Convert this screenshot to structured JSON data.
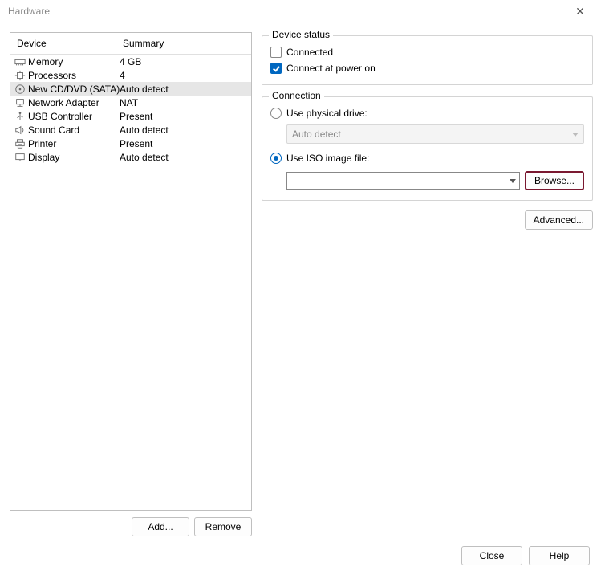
{
  "title": "Hardware",
  "list_header": {
    "device": "Device",
    "summary": "Summary"
  },
  "devices": [
    {
      "icon": "memory",
      "name": "Memory",
      "summary": "4 GB"
    },
    {
      "icon": "cpu",
      "name": "Processors",
      "summary": "4"
    },
    {
      "icon": "disc",
      "name": "New CD/DVD (SATA)",
      "summary": "Auto detect"
    },
    {
      "icon": "network",
      "name": "Network Adapter",
      "summary": "NAT"
    },
    {
      "icon": "usb",
      "name": "USB Controller",
      "summary": "Present"
    },
    {
      "icon": "sound",
      "name": "Sound Card",
      "summary": "Auto detect"
    },
    {
      "icon": "printer",
      "name": "Printer",
      "summary": "Present"
    },
    {
      "icon": "display",
      "name": "Display",
      "summary": "Auto detect"
    }
  ],
  "selected_index": 2,
  "buttons": {
    "add": "Add...",
    "remove": "Remove",
    "advanced": "Advanced...",
    "browse": "Browse...",
    "close": "Close",
    "help": "Help"
  },
  "device_status": {
    "legend": "Device status",
    "connected_label": "Connected",
    "connected_checked": false,
    "power_on_label": "Connect at power on",
    "power_on_checked": true
  },
  "connection": {
    "legend": "Connection",
    "physical_label": "Use physical drive:",
    "physical_selected": false,
    "physical_drive_value": "Auto detect",
    "iso_label": "Use ISO image file:",
    "iso_selected": true,
    "iso_value": ""
  }
}
